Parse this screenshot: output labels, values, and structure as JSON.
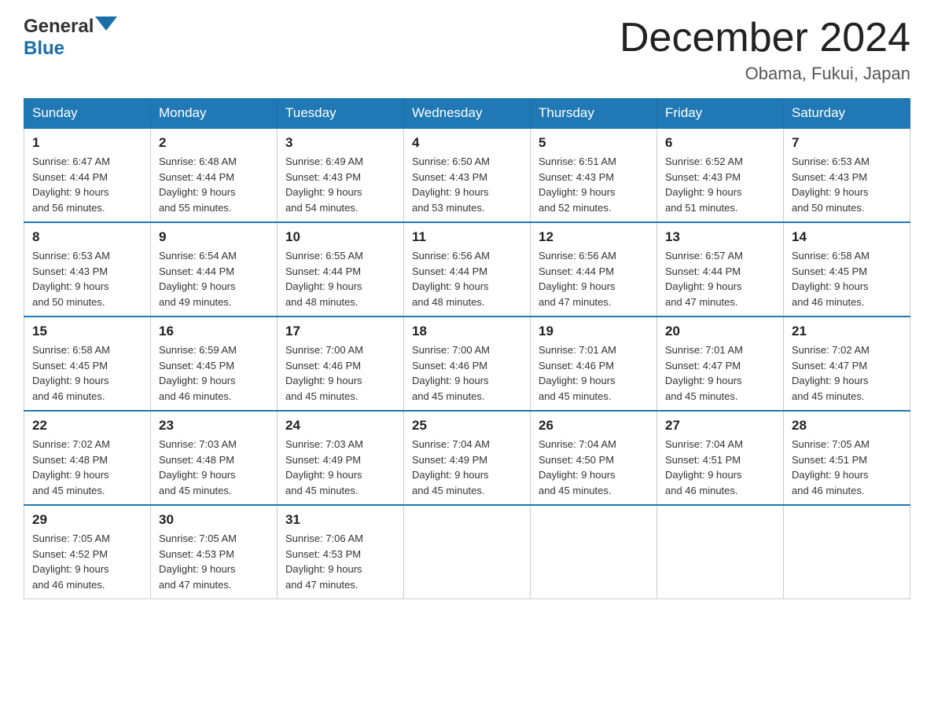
{
  "header": {
    "logo_line1": "General",
    "logo_line2": "Blue",
    "title": "December 2024",
    "subtitle": "Obama, Fukui, Japan"
  },
  "days_of_week": [
    "Sunday",
    "Monday",
    "Tuesday",
    "Wednesday",
    "Thursday",
    "Friday",
    "Saturday"
  ],
  "weeks": [
    [
      {
        "num": "1",
        "sunrise": "6:47 AM",
        "sunset": "4:44 PM",
        "daylight": "9 hours and 56 minutes."
      },
      {
        "num": "2",
        "sunrise": "6:48 AM",
        "sunset": "4:44 PM",
        "daylight": "9 hours and 55 minutes."
      },
      {
        "num": "3",
        "sunrise": "6:49 AM",
        "sunset": "4:43 PM",
        "daylight": "9 hours and 54 minutes."
      },
      {
        "num": "4",
        "sunrise": "6:50 AM",
        "sunset": "4:43 PM",
        "daylight": "9 hours and 53 minutes."
      },
      {
        "num": "5",
        "sunrise": "6:51 AM",
        "sunset": "4:43 PM",
        "daylight": "9 hours and 52 minutes."
      },
      {
        "num": "6",
        "sunrise": "6:52 AM",
        "sunset": "4:43 PM",
        "daylight": "9 hours and 51 minutes."
      },
      {
        "num": "7",
        "sunrise": "6:53 AM",
        "sunset": "4:43 PM",
        "daylight": "9 hours and 50 minutes."
      }
    ],
    [
      {
        "num": "8",
        "sunrise": "6:53 AM",
        "sunset": "4:43 PM",
        "daylight": "9 hours and 50 minutes."
      },
      {
        "num": "9",
        "sunrise": "6:54 AM",
        "sunset": "4:44 PM",
        "daylight": "9 hours and 49 minutes."
      },
      {
        "num": "10",
        "sunrise": "6:55 AM",
        "sunset": "4:44 PM",
        "daylight": "9 hours and 48 minutes."
      },
      {
        "num": "11",
        "sunrise": "6:56 AM",
        "sunset": "4:44 PM",
        "daylight": "9 hours and 48 minutes."
      },
      {
        "num": "12",
        "sunrise": "6:56 AM",
        "sunset": "4:44 PM",
        "daylight": "9 hours and 47 minutes."
      },
      {
        "num": "13",
        "sunrise": "6:57 AM",
        "sunset": "4:44 PM",
        "daylight": "9 hours and 47 minutes."
      },
      {
        "num": "14",
        "sunrise": "6:58 AM",
        "sunset": "4:45 PM",
        "daylight": "9 hours and 46 minutes."
      }
    ],
    [
      {
        "num": "15",
        "sunrise": "6:58 AM",
        "sunset": "4:45 PM",
        "daylight": "9 hours and 46 minutes."
      },
      {
        "num": "16",
        "sunrise": "6:59 AM",
        "sunset": "4:45 PM",
        "daylight": "9 hours and 46 minutes."
      },
      {
        "num": "17",
        "sunrise": "7:00 AM",
        "sunset": "4:46 PM",
        "daylight": "9 hours and 45 minutes."
      },
      {
        "num": "18",
        "sunrise": "7:00 AM",
        "sunset": "4:46 PM",
        "daylight": "9 hours and 45 minutes."
      },
      {
        "num": "19",
        "sunrise": "7:01 AM",
        "sunset": "4:46 PM",
        "daylight": "9 hours and 45 minutes."
      },
      {
        "num": "20",
        "sunrise": "7:01 AM",
        "sunset": "4:47 PM",
        "daylight": "9 hours and 45 minutes."
      },
      {
        "num": "21",
        "sunrise": "7:02 AM",
        "sunset": "4:47 PM",
        "daylight": "9 hours and 45 minutes."
      }
    ],
    [
      {
        "num": "22",
        "sunrise": "7:02 AM",
        "sunset": "4:48 PM",
        "daylight": "9 hours and 45 minutes."
      },
      {
        "num": "23",
        "sunrise": "7:03 AM",
        "sunset": "4:48 PM",
        "daylight": "9 hours and 45 minutes."
      },
      {
        "num": "24",
        "sunrise": "7:03 AM",
        "sunset": "4:49 PM",
        "daylight": "9 hours and 45 minutes."
      },
      {
        "num": "25",
        "sunrise": "7:04 AM",
        "sunset": "4:49 PM",
        "daylight": "9 hours and 45 minutes."
      },
      {
        "num": "26",
        "sunrise": "7:04 AM",
        "sunset": "4:50 PM",
        "daylight": "9 hours and 45 minutes."
      },
      {
        "num": "27",
        "sunrise": "7:04 AM",
        "sunset": "4:51 PM",
        "daylight": "9 hours and 46 minutes."
      },
      {
        "num": "28",
        "sunrise": "7:05 AM",
        "sunset": "4:51 PM",
        "daylight": "9 hours and 46 minutes."
      }
    ],
    [
      {
        "num": "29",
        "sunrise": "7:05 AM",
        "sunset": "4:52 PM",
        "daylight": "9 hours and 46 minutes."
      },
      {
        "num": "30",
        "sunrise": "7:05 AM",
        "sunset": "4:53 PM",
        "daylight": "9 hours and 47 minutes."
      },
      {
        "num": "31",
        "sunrise": "7:06 AM",
        "sunset": "4:53 PM",
        "daylight": "9 hours and 47 minutes."
      },
      null,
      null,
      null,
      null
    ]
  ]
}
